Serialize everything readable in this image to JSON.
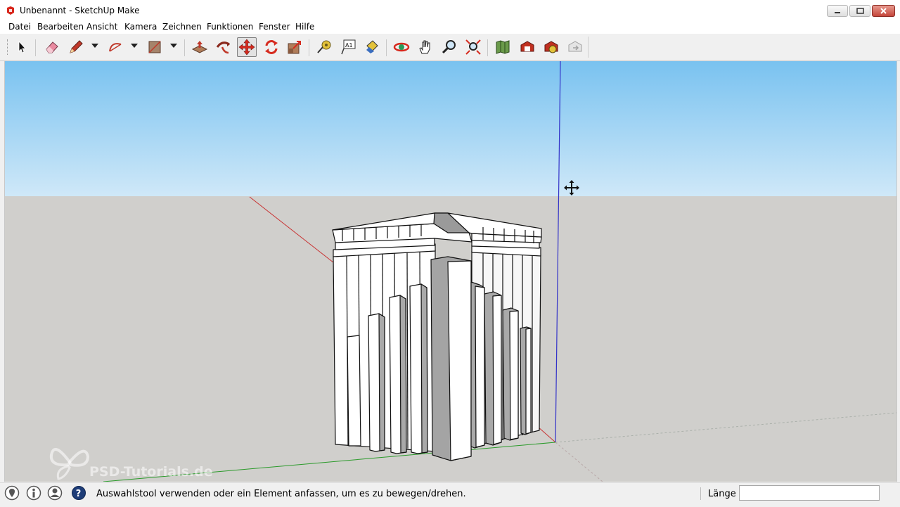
{
  "window": {
    "title": "Unbenannt - SketchUp Make",
    "app_icon": "sketchup-icon",
    "controls": [
      "minimize-icon",
      "maximize-icon",
      "close-icon"
    ]
  },
  "menu": [
    "Datei",
    "Bearbeiten",
    "Ansicht",
    "Kamera",
    "Zeichnen",
    "Funktionen",
    "Fenster",
    "Hilfe"
  ],
  "toolbar": {
    "tools": [
      {
        "name": "select-tool",
        "icon": "arrow-cursor-icon"
      },
      {
        "name": "eraser-tool",
        "icon": "eraser-icon"
      },
      {
        "name": "pencil-tool",
        "icon": "pencil-icon",
        "dropdown": true
      },
      {
        "name": "arc-tool",
        "icon": "arc-icon",
        "dropdown": true
      },
      {
        "name": "rectangle-tool",
        "icon": "rectangle-icon",
        "dropdown": true
      },
      {
        "name": "push-pull-tool",
        "icon": "push-pull-icon"
      },
      {
        "name": "follow-me-tool",
        "icon": "follow-me-icon"
      },
      {
        "name": "move-tool",
        "icon": "move-icon",
        "active": true
      },
      {
        "name": "rotate-tool",
        "icon": "rotate-icon"
      },
      {
        "name": "scale-tool",
        "icon": "scale-icon"
      },
      {
        "name": "tape-measure-tool",
        "icon": "tape-measure-icon"
      },
      {
        "name": "text-tool",
        "icon": "text-icon"
      },
      {
        "name": "paint-bucket-tool",
        "icon": "paint-bucket-icon"
      },
      {
        "name": "orbit-tool",
        "icon": "orbit-icon"
      },
      {
        "name": "pan-tool",
        "icon": "hand-icon"
      },
      {
        "name": "zoom-tool",
        "icon": "magnifier-icon"
      },
      {
        "name": "zoom-extents-tool",
        "icon": "zoom-extents-icon"
      },
      {
        "name": "add-location-tool",
        "icon": "map-icon"
      },
      {
        "name": "3d-warehouse-tool",
        "icon": "warehouse-icon"
      },
      {
        "name": "extension-warehouse-tool",
        "icon": "extension-icon"
      },
      {
        "name": "share-model-tool",
        "icon": "share-icon"
      }
    ]
  },
  "viewport": {
    "sky_color": "#79c2f0",
    "ground_color": "#d0cfcc",
    "axis_colors": {
      "red": "#c83232",
      "green": "#2a9a2a",
      "blue": "#3232c8"
    },
    "cursor": "move-cursor-icon",
    "watermark": "PSD-Tutorials.de"
  },
  "statusbar": {
    "icons": [
      "geolocation-icon",
      "credits-icon",
      "user-icon",
      "help-icon"
    ],
    "message": "Auswahlstool verwenden oder ein Element anfassen, um es zu bewegen/drehen.",
    "length_label": "Länge",
    "length_value": ""
  }
}
